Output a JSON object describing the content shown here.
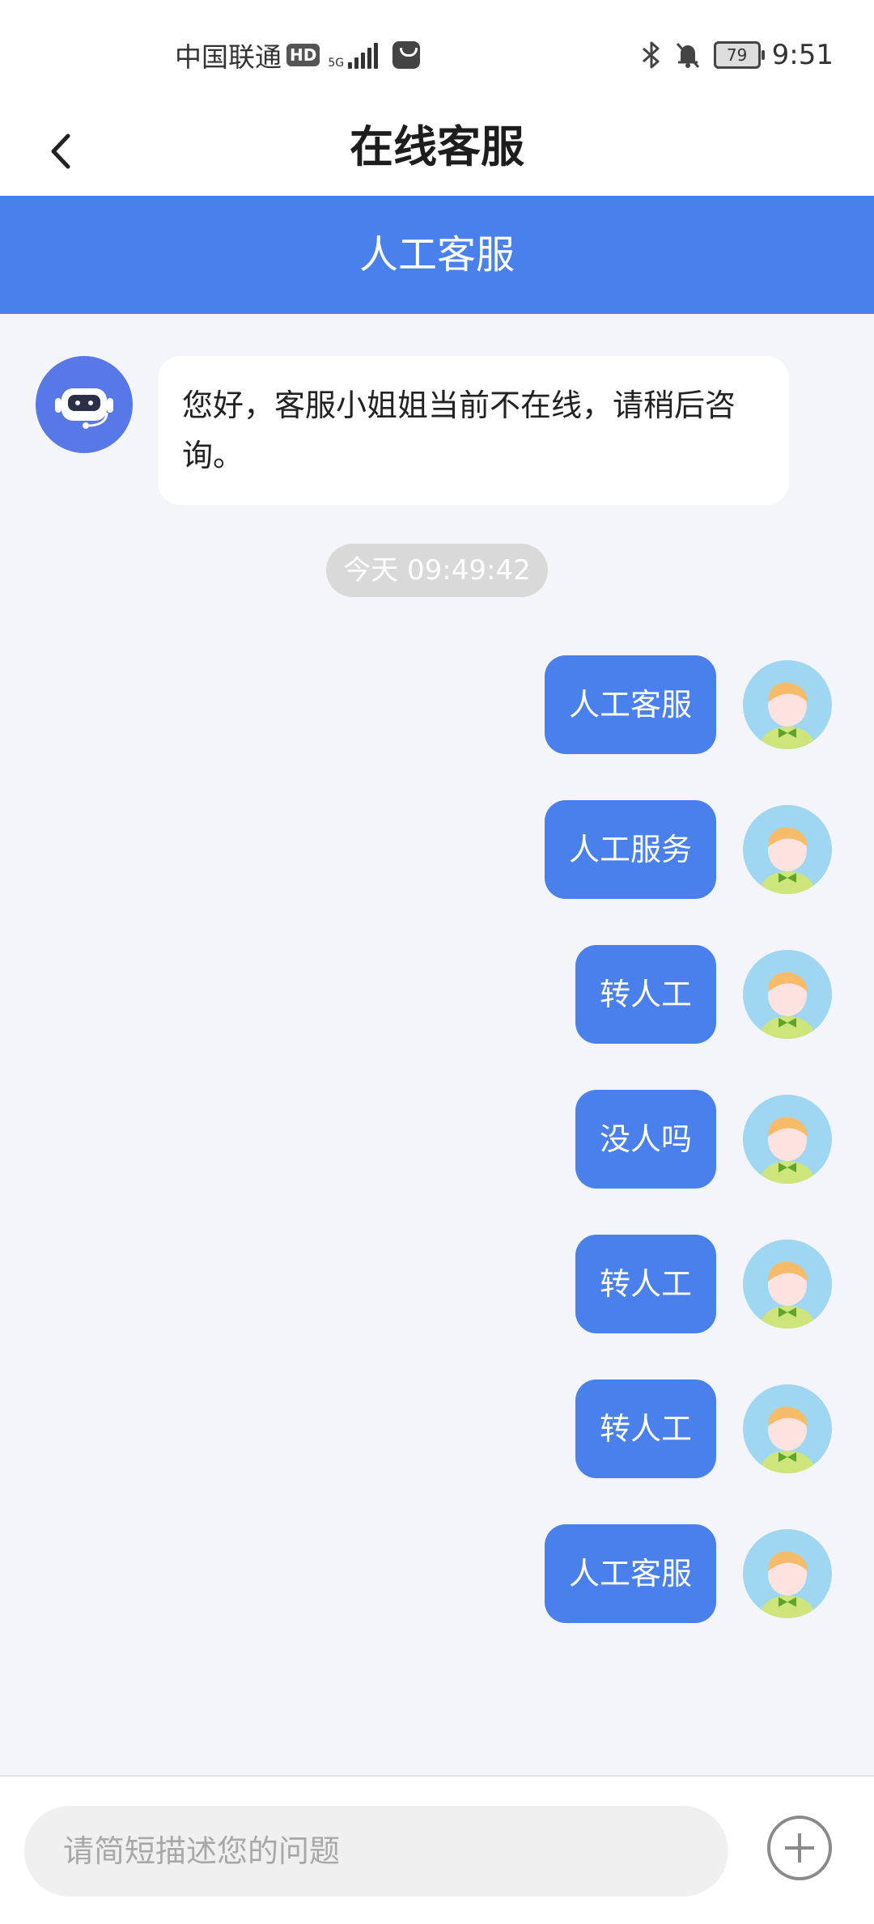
{
  "status_bar": {
    "carrier": "中国联通",
    "hd_badge": "HD",
    "network": "5G",
    "battery": "79",
    "time": "9:51"
  },
  "nav": {
    "title": "在线客服",
    "back_icon": "chevron-left-icon"
  },
  "tab": {
    "label": "人工客服"
  },
  "chat": {
    "bot_message": "您好，客服小姐姐当前不在线，请稍后咨询。",
    "timestamp": "今天 09:49:42",
    "user_messages": [
      "人工客服",
      "人工服务",
      "转人工",
      "没人吗",
      "转人工",
      "转人工",
      "人工客服"
    ]
  },
  "input": {
    "placeholder": "请简短描述您的问题",
    "value": ""
  },
  "colors": {
    "accent": "#4a80eb",
    "background": "#f4f5fa",
    "bot_avatar": "#5778e6"
  }
}
